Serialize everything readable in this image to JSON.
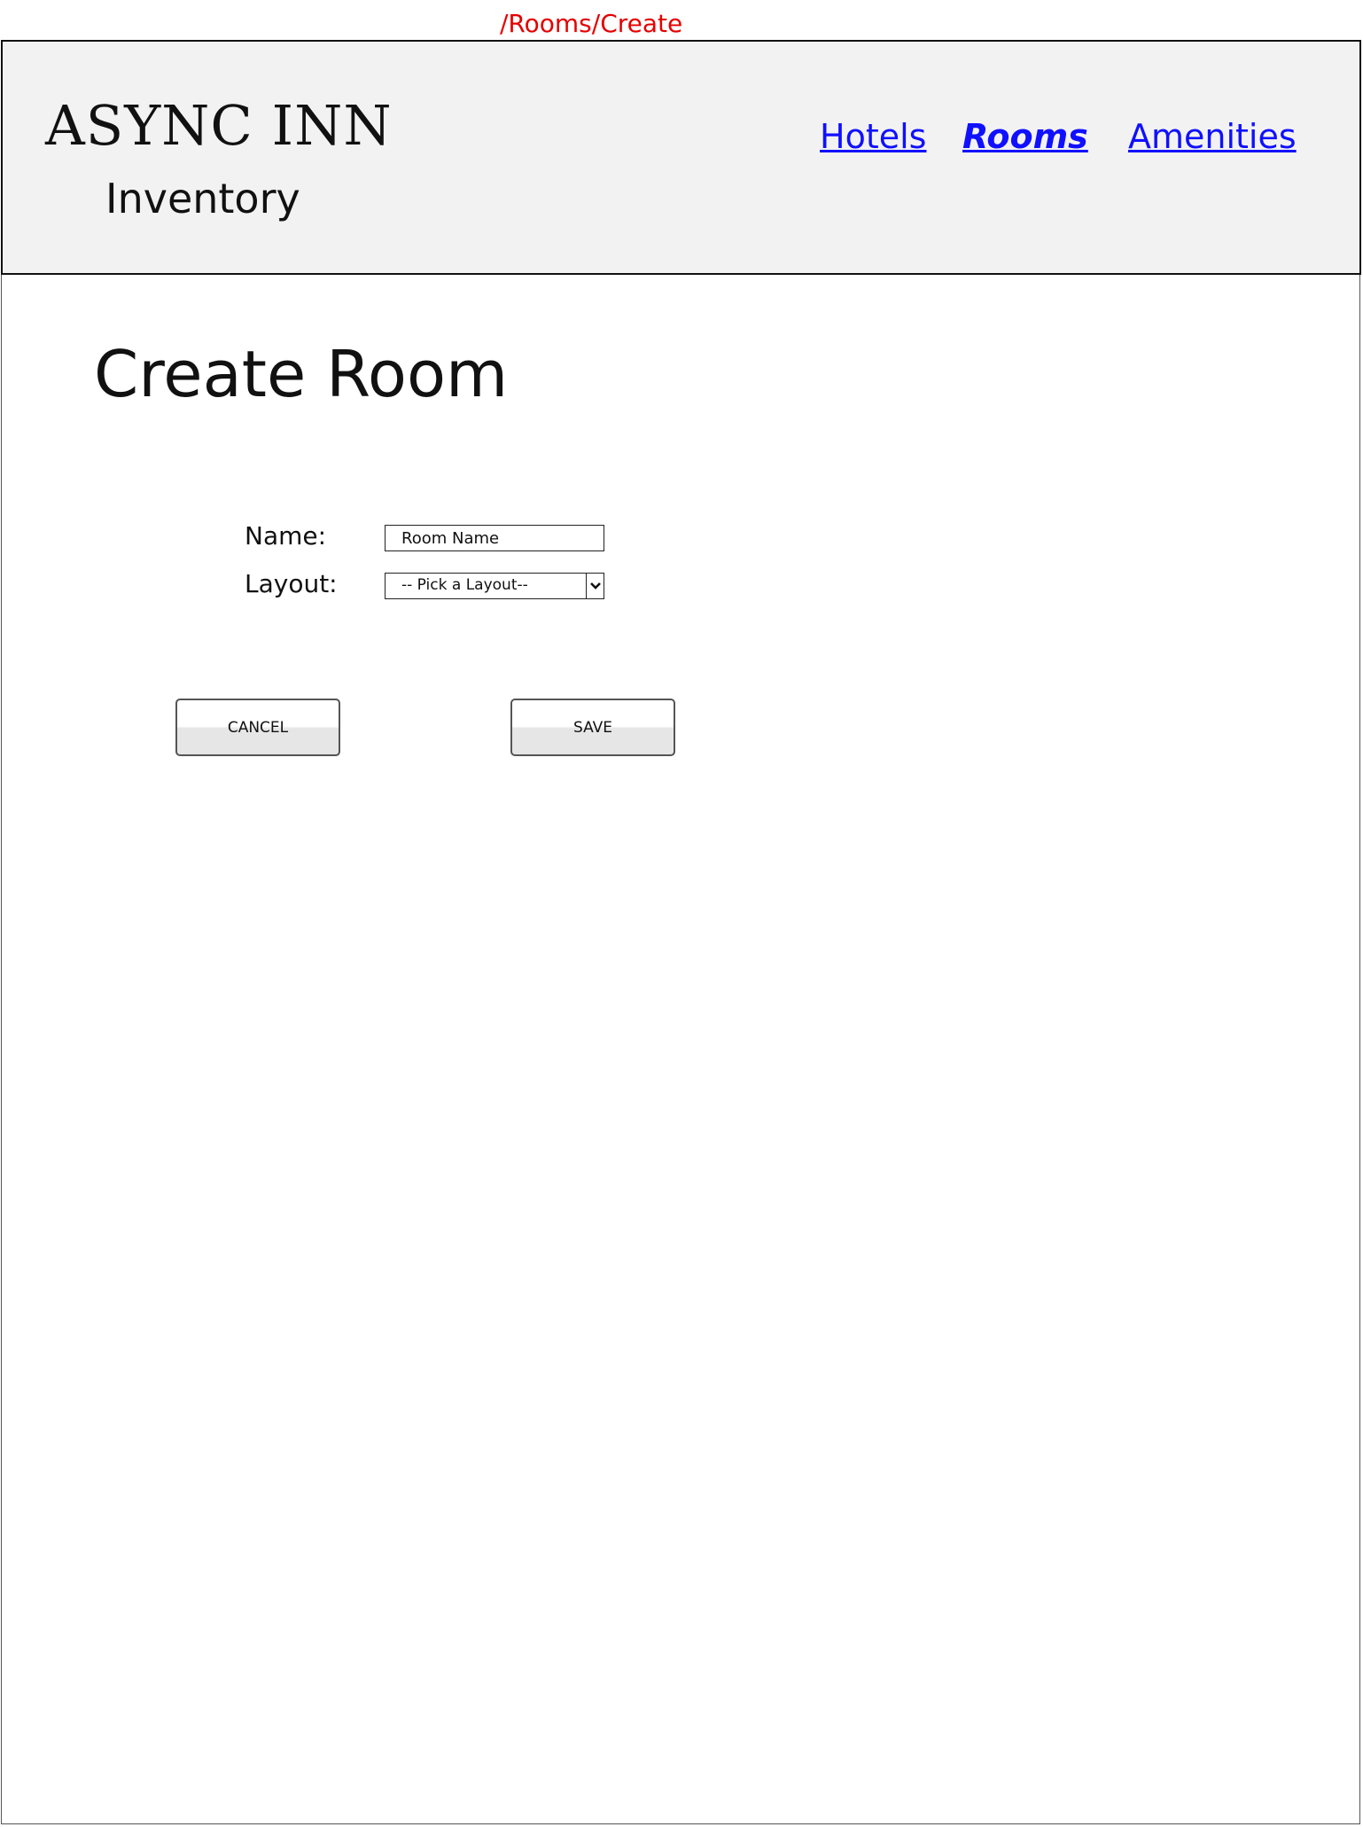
{
  "route": "/Rooms/Create",
  "header": {
    "brand_title": "ASYNC INN",
    "brand_subtitle": "Inventory",
    "nav": [
      {
        "label": "Hotels",
        "active": false
      },
      {
        "label": "Rooms",
        "active": true
      },
      {
        "label": "Amenities",
        "active": false
      }
    ]
  },
  "main": {
    "page_title": "Create Room",
    "form": {
      "name_label": "Name:",
      "name_placeholder": "Room Name",
      "layout_label": "Layout:",
      "layout_selected": "-- Pick a Layout--",
      "layout_icon": "chevron-down-icon"
    },
    "buttons": {
      "cancel_label": "CANCEL",
      "save_label": "SAVE"
    }
  },
  "colors": {
    "route": "#e60000",
    "link": "#1010ff",
    "header_bg": "#f2f2f2"
  }
}
